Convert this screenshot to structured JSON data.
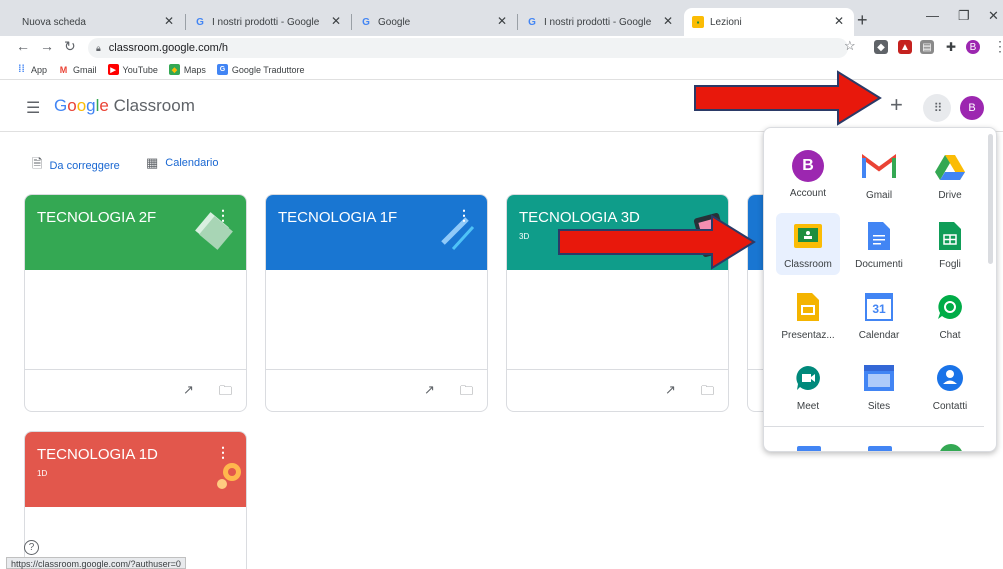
{
  "browser": {
    "tabs": [
      {
        "label": "Nuova scheda"
      },
      {
        "label": "I nostri prodotti - Google"
      },
      {
        "label": "Google"
      },
      {
        "label": "I nostri prodotti - Google"
      },
      {
        "label": "Lezioni"
      }
    ],
    "url": "classroom.google.com/h",
    "bookmarks": [
      "App",
      "Gmail",
      "YouTube",
      "Maps",
      "Google Traduttore"
    ],
    "profile_initial": "B"
  },
  "header": {
    "logo_google": [
      "G",
      "o",
      "o",
      "g",
      "l",
      "e"
    ],
    "logo_product": "Classroom",
    "avatar_initial": "B"
  },
  "quick_links": [
    "Da correggere",
    "Calendario"
  ],
  "classes": [
    {
      "title": "TECNOLOGIA 2F",
      "section": "",
      "color": "#34a853"
    },
    {
      "title": "TECNOLOGIA 1F",
      "section": "",
      "color": "#1976d2"
    },
    {
      "title": "TECNOLOGIA 3D",
      "section": "3D",
      "color": "#0f9d8a"
    },
    {
      "title": "TECNOLOGIA 1D",
      "section": "1D",
      "color": "#e2574c"
    }
  ],
  "apps": [
    {
      "label": "Account",
      "icon": "account-icon"
    },
    {
      "label": "Gmail",
      "icon": "gmail-icon"
    },
    {
      "label": "Drive",
      "icon": "drive-icon"
    },
    {
      "label": "Classroom",
      "icon": "classroom-icon"
    },
    {
      "label": "Documenti",
      "icon": "docs-icon"
    },
    {
      "label": "Fogli",
      "icon": "sheets-icon"
    },
    {
      "label": "Presentaz...",
      "icon": "slides-icon"
    },
    {
      "label": "Calendar",
      "icon": "calendar-icon"
    },
    {
      "label": "Chat",
      "icon": "chat-icon"
    },
    {
      "label": "Meet",
      "icon": "meet-icon"
    },
    {
      "label": "Sites",
      "icon": "sites-icon"
    },
    {
      "label": "Contatti",
      "icon": "contacts-icon"
    }
  ],
  "apps_icon_text": {
    "account": "B",
    "calendar": "31"
  },
  "status_url": "https://classroom.google.com/?authuser=0",
  "colors": {
    "arrow": "#e8180c",
    "accent": "#1967d2"
  }
}
